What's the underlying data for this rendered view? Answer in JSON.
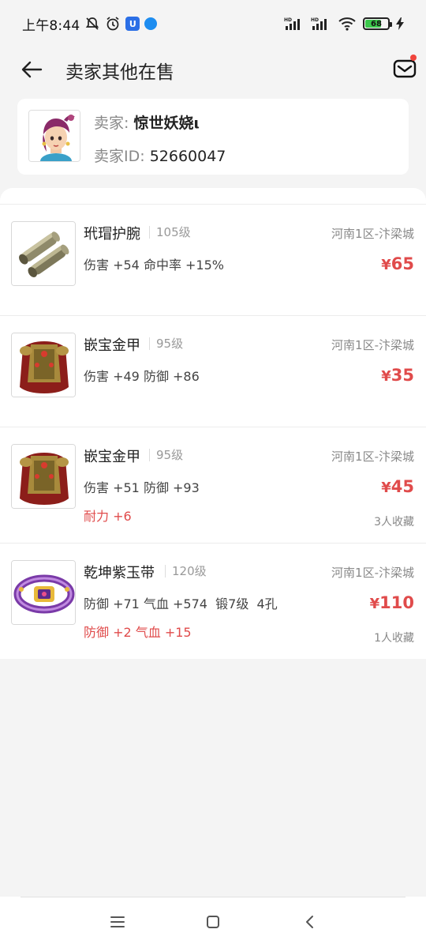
{
  "status_bar": {
    "time": "上午8:44",
    "battery": "68",
    "icons": [
      "mute-icon",
      "alarm-icon",
      "app-u-icon",
      "message-icon",
      "hd-signal-icon",
      "hd-signal-icon",
      "wifi-icon",
      "battery-icon",
      "charging-icon"
    ]
  },
  "header": {
    "title": "卖家其他在售",
    "back_icon": "back-arrow-icon",
    "mail_icon": "mail-icon"
  },
  "seller": {
    "name_label": "卖家:",
    "name": "惊世妖娆ι",
    "id_label": "卖家ID:",
    "id": "52660047"
  },
  "items": [
    {
      "name": "玳瑁护腕",
      "level": "105级",
      "server": "河南1区-汴梁城",
      "stats": "伤害 +54 命中率 +15%",
      "extra": "",
      "currency": "¥",
      "price": "65",
      "favorites": "",
      "thumb": "bracer"
    },
    {
      "name": "嵌宝金甲",
      "level": "95级",
      "server": "河南1区-汴梁城",
      "stats": "伤害 +49 防御 +86",
      "extra": "",
      "currency": "¥",
      "price": "35",
      "favorites": "",
      "thumb": "armor"
    },
    {
      "name": "嵌宝金甲",
      "level": "95级",
      "server": "河南1区-汴梁城",
      "stats": "伤害 +51 防御 +93",
      "extra": "耐力 +6",
      "currency": "¥",
      "price": "45",
      "favorites": "3人收藏",
      "thumb": "armor"
    },
    {
      "name": "乾坤紫玉带",
      "level": "120级",
      "server": "河南1区-汴梁城",
      "stats": "防御 +71 气血 +574  锻7级  4孔",
      "extra": "防御 +2 气血 +15",
      "currency": "¥",
      "price": "110",
      "favorites": "1人收藏",
      "thumb": "belt"
    }
  ],
  "colors": {
    "price": "#e04b4b",
    "accent_dot": "#f0443c"
  }
}
